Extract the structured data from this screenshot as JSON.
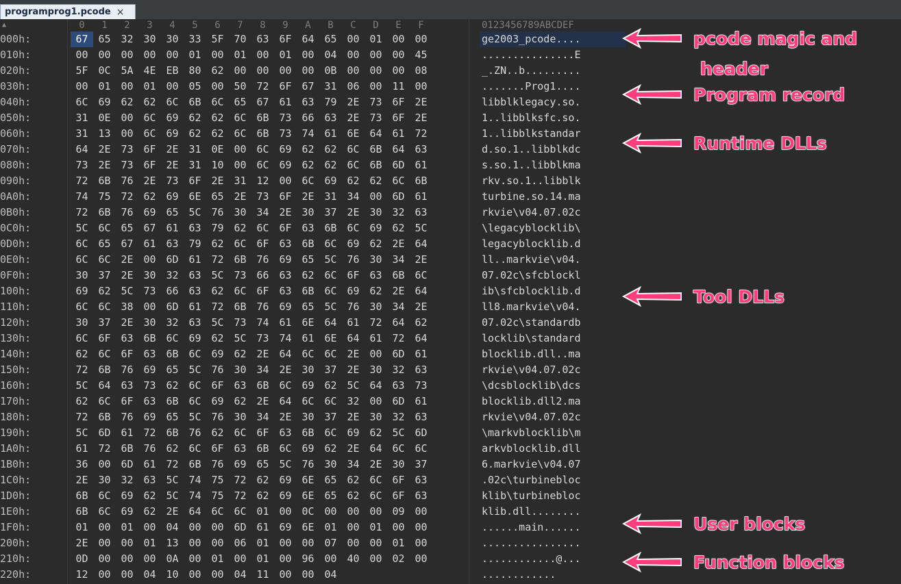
{
  "tab": {
    "title": "programprog1.pcode",
    "close": "×"
  },
  "header": {
    "columns": [
      "0",
      "1",
      "2",
      "3",
      "4",
      "5",
      "6",
      "7",
      "8",
      "9",
      "A",
      "B",
      "C",
      "D",
      "E",
      "F"
    ],
    "ascii": "0123456789ABCDEF"
  },
  "rows": [
    {
      "addr": "000h:",
      "hex": [
        "67",
        "65",
        "32",
        "30",
        "30",
        "33",
        "5F",
        "70",
        "63",
        "6F",
        "64",
        "65",
        "00",
        "01",
        "00",
        "00"
      ],
      "ascii": "ge2003_pcode...."
    },
    {
      "addr": "010h:",
      "hex": [
        "00",
        "00",
        "00",
        "00",
        "00",
        "01",
        "00",
        "01",
        "00",
        "01",
        "00",
        "04",
        "00",
        "00",
        "00",
        "45"
      ],
      "ascii": "...............E"
    },
    {
      "addr": "020h:",
      "hex": [
        "5F",
        "0C",
        "5A",
        "4E",
        "EB",
        "80",
        "62",
        "00",
        "00",
        "00",
        "00",
        "0B",
        "00",
        "00",
        "00",
        "08"
      ],
      "ascii": "_.ZN..b........."
    },
    {
      "addr": "030h:",
      "hex": [
        "00",
        "01",
        "00",
        "01",
        "00",
        "05",
        "00",
        "50",
        "72",
        "6F",
        "67",
        "31",
        "06",
        "00",
        "11",
        "00"
      ],
      "ascii": ".......Prog1...."
    },
    {
      "addr": "040h:",
      "hex": [
        "6C",
        "69",
        "62",
        "62",
        "6C",
        "6B",
        "6C",
        "65",
        "67",
        "61",
        "63",
        "79",
        "2E",
        "73",
        "6F",
        "2E"
      ],
      "ascii": "libblklegacy.so."
    },
    {
      "addr": "050h:",
      "hex": [
        "31",
        "0E",
        "00",
        "6C",
        "69",
        "62",
        "62",
        "6C",
        "6B",
        "73",
        "66",
        "63",
        "2E",
        "73",
        "6F",
        "2E"
      ],
      "ascii": "1..libblksfc.so."
    },
    {
      "addr": "060h:",
      "hex": [
        "31",
        "13",
        "00",
        "6C",
        "69",
        "62",
        "62",
        "6C",
        "6B",
        "73",
        "74",
        "61",
        "6E",
        "64",
        "61",
        "72"
      ],
      "ascii": "1..libblkstandar"
    },
    {
      "addr": "070h:",
      "hex": [
        "64",
        "2E",
        "73",
        "6F",
        "2E",
        "31",
        "0E",
        "00",
        "6C",
        "69",
        "62",
        "62",
        "6C",
        "6B",
        "64",
        "63"
      ],
      "ascii": "d.so.1..libblkdc"
    },
    {
      "addr": "080h:",
      "hex": [
        "73",
        "2E",
        "73",
        "6F",
        "2E",
        "31",
        "10",
        "00",
        "6C",
        "69",
        "62",
        "62",
        "6C",
        "6B",
        "6D",
        "61"
      ],
      "ascii": "s.so.1..libblkma"
    },
    {
      "addr": "090h:",
      "hex": [
        "72",
        "6B",
        "76",
        "2E",
        "73",
        "6F",
        "2E",
        "31",
        "12",
        "00",
        "6C",
        "69",
        "62",
        "62",
        "6C",
        "6B"
      ],
      "ascii": "rkv.so.1..libblk"
    },
    {
      "addr": "0A0h:",
      "hex": [
        "74",
        "75",
        "72",
        "62",
        "69",
        "6E",
        "65",
        "2E",
        "73",
        "6F",
        "2E",
        "31",
        "34",
        "00",
        "6D",
        "61"
      ],
      "ascii": "turbine.so.14.ma"
    },
    {
      "addr": "0B0h:",
      "hex": [
        "72",
        "6B",
        "76",
        "69",
        "65",
        "5C",
        "76",
        "30",
        "34",
        "2E",
        "30",
        "37",
        "2E",
        "30",
        "32",
        "63"
      ],
      "ascii": "rkvie\\v04.07.02c"
    },
    {
      "addr": "0C0h:",
      "hex": [
        "5C",
        "6C",
        "65",
        "67",
        "61",
        "63",
        "79",
        "62",
        "6C",
        "6F",
        "63",
        "6B",
        "6C",
        "69",
        "62",
        "5C"
      ],
      "ascii": "\\legacyblocklib\\"
    },
    {
      "addr": "0D0h:",
      "hex": [
        "6C",
        "65",
        "67",
        "61",
        "63",
        "79",
        "62",
        "6C",
        "6F",
        "63",
        "6B",
        "6C",
        "69",
        "62",
        "2E",
        "64"
      ],
      "ascii": "legacyblocklib.d"
    },
    {
      "addr": "0E0h:",
      "hex": [
        "6C",
        "6C",
        "2E",
        "00",
        "6D",
        "61",
        "72",
        "6B",
        "76",
        "69",
        "65",
        "5C",
        "76",
        "30",
        "34",
        "2E"
      ],
      "ascii": "ll..markvie\\v04."
    },
    {
      "addr": "0F0h:",
      "hex": [
        "30",
        "37",
        "2E",
        "30",
        "32",
        "63",
        "5C",
        "73",
        "66",
        "63",
        "62",
        "6C",
        "6F",
        "63",
        "6B",
        "6C"
      ],
      "ascii": "07.02c\\sfcblockl"
    },
    {
      "addr": "100h:",
      "hex": [
        "69",
        "62",
        "5C",
        "73",
        "66",
        "63",
        "62",
        "6C",
        "6F",
        "63",
        "6B",
        "6C",
        "69",
        "62",
        "2E",
        "64"
      ],
      "ascii": "ib\\sfcblocklib.d"
    },
    {
      "addr": "110h:",
      "hex": [
        "6C",
        "6C",
        "38",
        "00",
        "6D",
        "61",
        "72",
        "6B",
        "76",
        "69",
        "65",
        "5C",
        "76",
        "30",
        "34",
        "2E"
      ],
      "ascii": "ll8.markvie\\v04."
    },
    {
      "addr": "120h:",
      "hex": [
        "30",
        "37",
        "2E",
        "30",
        "32",
        "63",
        "5C",
        "73",
        "74",
        "61",
        "6E",
        "64",
        "61",
        "72",
        "64",
        "62"
      ],
      "ascii": "07.02c\\standardb"
    },
    {
      "addr": "130h:",
      "hex": [
        "6C",
        "6F",
        "63",
        "6B",
        "6C",
        "69",
        "62",
        "5C",
        "73",
        "74",
        "61",
        "6E",
        "64",
        "61",
        "72",
        "64"
      ],
      "ascii": "locklib\\standard"
    },
    {
      "addr": "140h:",
      "hex": [
        "62",
        "6C",
        "6F",
        "63",
        "6B",
        "6C",
        "69",
        "62",
        "2E",
        "64",
        "6C",
        "6C",
        "2E",
        "00",
        "6D",
        "61"
      ],
      "ascii": "blocklib.dll..ma"
    },
    {
      "addr": "150h:",
      "hex": [
        "72",
        "6B",
        "76",
        "69",
        "65",
        "5C",
        "76",
        "30",
        "34",
        "2E",
        "30",
        "37",
        "2E",
        "30",
        "32",
        "63"
      ],
      "ascii": "rkvie\\v04.07.02c"
    },
    {
      "addr": "160h:",
      "hex": [
        "5C",
        "64",
        "63",
        "73",
        "62",
        "6C",
        "6F",
        "63",
        "6B",
        "6C",
        "69",
        "62",
        "5C",
        "64",
        "63",
        "73"
      ],
      "ascii": "\\dcsblocklib\\dcs"
    },
    {
      "addr": "170h:",
      "hex": [
        "62",
        "6C",
        "6F",
        "63",
        "6B",
        "6C",
        "69",
        "62",
        "2E",
        "64",
        "6C",
        "6C",
        "32",
        "00",
        "6D",
        "61"
      ],
      "ascii": "blocklib.dll2.ma"
    },
    {
      "addr": "180h:",
      "hex": [
        "72",
        "6B",
        "76",
        "69",
        "65",
        "5C",
        "76",
        "30",
        "34",
        "2E",
        "30",
        "37",
        "2E",
        "30",
        "32",
        "63"
      ],
      "ascii": "rkvie\\v04.07.02c"
    },
    {
      "addr": "190h:",
      "hex": [
        "5C",
        "6D",
        "61",
        "72",
        "6B",
        "76",
        "62",
        "6C",
        "6F",
        "63",
        "6B",
        "6C",
        "69",
        "62",
        "5C",
        "6D"
      ],
      "ascii": "\\markvblocklib\\m"
    },
    {
      "addr": "1A0h:",
      "hex": [
        "61",
        "72",
        "6B",
        "76",
        "62",
        "6C",
        "6F",
        "63",
        "6B",
        "6C",
        "69",
        "62",
        "2E",
        "64",
        "6C",
        "6C"
      ],
      "ascii": "arkvblocklib.dll"
    },
    {
      "addr": "1B0h:",
      "hex": [
        "36",
        "00",
        "6D",
        "61",
        "72",
        "6B",
        "76",
        "69",
        "65",
        "5C",
        "76",
        "30",
        "34",
        "2E",
        "30",
        "37"
      ],
      "ascii": "6.markvie\\v04.07"
    },
    {
      "addr": "1C0h:",
      "hex": [
        "2E",
        "30",
        "32",
        "63",
        "5C",
        "74",
        "75",
        "72",
        "62",
        "69",
        "6E",
        "65",
        "62",
        "6C",
        "6F",
        "63"
      ],
      "ascii": ".02c\\turbinebloc"
    },
    {
      "addr": "1D0h:",
      "hex": [
        "6B",
        "6C",
        "69",
        "62",
        "5C",
        "74",
        "75",
        "72",
        "62",
        "69",
        "6E",
        "65",
        "62",
        "6C",
        "6F",
        "63"
      ],
      "ascii": "klib\\turbinebloc"
    },
    {
      "addr": "1E0h:",
      "hex": [
        "6B",
        "6C",
        "69",
        "62",
        "2E",
        "64",
        "6C",
        "6C",
        "01",
        "00",
        "0C",
        "00",
        "00",
        "00",
        "09",
        "00"
      ],
      "ascii": "klib.dll........"
    },
    {
      "addr": "1F0h:",
      "hex": [
        "01",
        "00",
        "01",
        "00",
        "04",
        "00",
        "00",
        "6D",
        "61",
        "69",
        "6E",
        "01",
        "00",
        "01",
        "00",
        "00"
      ],
      "ascii": "......main......"
    },
    {
      "addr": "200h:",
      "hex": [
        "2E",
        "00",
        "00",
        "01",
        "13",
        "00",
        "00",
        "06",
        "01",
        "00",
        "00",
        "07",
        "00",
        "00",
        "01",
        "00"
      ],
      "ascii": "................"
    },
    {
      "addr": "210h:",
      "hex": [
        "0D",
        "00",
        "00",
        "00",
        "0A",
        "00",
        "01",
        "00",
        "01",
        "00",
        "96",
        "00",
        "40",
        "00",
        "02",
        "00"
      ],
      "ascii": "............@..."
    },
    {
      "addr": "220h:",
      "hex": [
        "12",
        "00",
        "00",
        "04",
        "10",
        "00",
        "00",
        "04",
        "11",
        "00",
        "00",
        "04"
      ],
      "ascii": "............"
    }
  ],
  "annotations": {
    "magic_line1": "pcode magic and",
    "magic_line2": "header",
    "program": "Program record",
    "runtime": "Runtime DLLs",
    "tool": "Tool DLLs",
    "user": "User blocks",
    "function": "Function blocks"
  },
  "colors": {
    "accent": "#ff3d7d",
    "background": "#2b2b2b",
    "selection": "#2c4a7a"
  }
}
